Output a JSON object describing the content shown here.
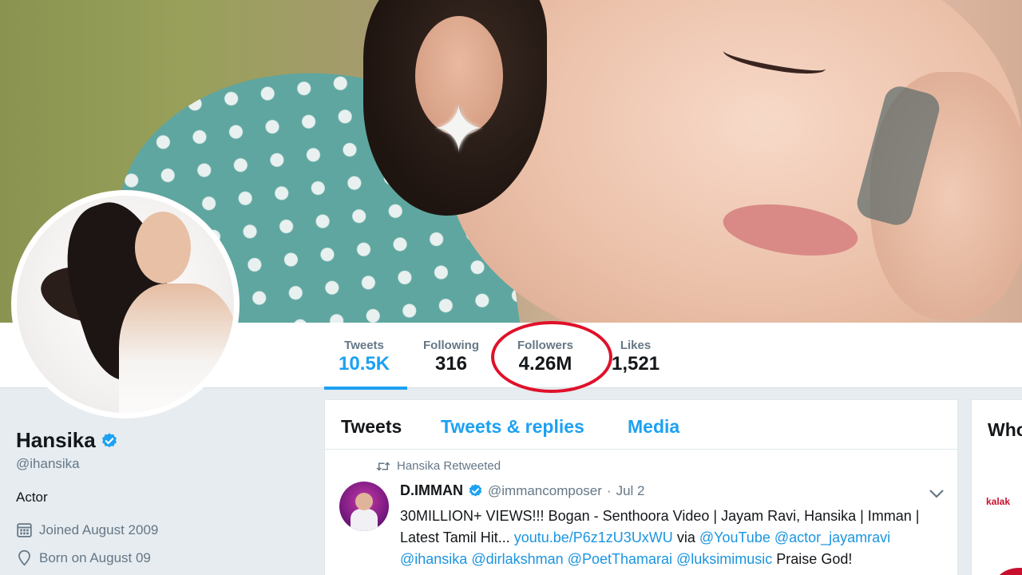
{
  "profile": {
    "name": "Hansika",
    "handle": "@ihansika",
    "bio": "Actor",
    "joined": "Joined August 2009",
    "born": "Born on August 09"
  },
  "nav": {
    "tweets": {
      "label": "Tweets",
      "value": "10.5K"
    },
    "following": {
      "label": "Following",
      "value": "316"
    },
    "followers": {
      "label": "Followers",
      "value": "4.26M"
    },
    "likes": {
      "label": "Likes",
      "value": "1,521"
    }
  },
  "tabs": {
    "tweets": "Tweets",
    "replies": "Tweets & replies",
    "media": "Media"
  },
  "tweet": {
    "retweeted_by": "Hansika Retweeted",
    "author_name": "D.IMMAN",
    "author_handle": "@immancomposer",
    "dot": "·",
    "date": "Jul 2",
    "text_1": "30MILLION+ VIEWS!!! Bogan - Senthoora Video | Jayam Ravi, Hansika | Imman |",
    "text_2a": "Latest Tamil Hit... ",
    "link_url": "youtu.be/P6z1zU3UxWU",
    "text_via": " via ",
    "mention_youtube": "@YouTube",
    "mention_jayam": "@actor_jayamravi",
    "mention_hansika": "@ihansika",
    "mention_lakshman": "@dirlakshman",
    "mention_thamarai": "@PoetThamarai",
    "mention_luksimi": "@luksimimusic",
    "text_end": " Praise God!"
  },
  "right": {
    "title": "Who",
    "logo_text": "kalak"
  },
  "colors": {
    "accent": "#1da1f2",
    "highlight": "#e0112a",
    "secondary_text": "#657786"
  },
  "icons": [
    "verified-badge-icon",
    "calendar-icon",
    "location-pin-icon",
    "retweet-icon",
    "chevron-down-icon"
  ]
}
